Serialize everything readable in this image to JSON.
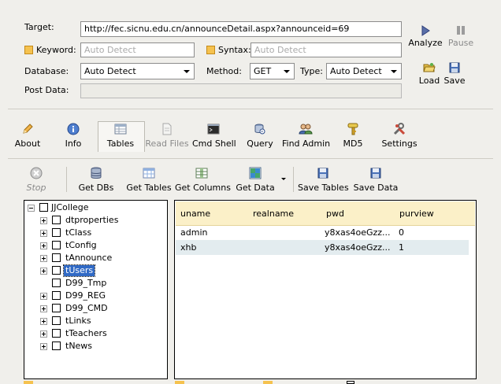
{
  "form": {
    "target_label": "Target:",
    "target_value": "http://fec.sicnu.edu.cn/announceDetail.aspx?announceid=69",
    "keyword_label": "Keyword:",
    "keyword_placeholder": "Auto Detect",
    "syntax_label": "Syntax:",
    "syntax_placeholder": "Auto Detect",
    "database_label": "Database:",
    "database_value": "Auto Detect",
    "method_label": "Method:",
    "method_value": "GET",
    "type_label": "Type:",
    "type_value": "Auto Detect",
    "postdata_label": "Post Data:",
    "postdata_value": ""
  },
  "actions": {
    "analyze": "Analyze",
    "pause": "Pause",
    "load": "Load",
    "save": "Save"
  },
  "tabs": [
    {
      "label": "About",
      "icon": "pen-icon"
    },
    {
      "label": "Info",
      "icon": "info-icon"
    },
    {
      "label": "Tables",
      "icon": "tables-icon"
    },
    {
      "label": "Read Files",
      "icon": "document-icon"
    },
    {
      "label": "Cmd Shell",
      "icon": "terminal-icon"
    },
    {
      "label": "Query",
      "icon": "query-icon"
    },
    {
      "label": "Find Admin",
      "icon": "users-icon"
    },
    {
      "label": "MD5",
      "icon": "key-icon"
    },
    {
      "label": "Settings",
      "icon": "tools-icon"
    }
  ],
  "toolbar": {
    "stop": "Stop",
    "get_dbs": "Get DBs",
    "get_tables": "Get Tables",
    "get_columns": "Get Columns",
    "get_data": "Get Data",
    "save_tables": "Save Tables",
    "save_data": "Save Data"
  },
  "tree": {
    "root": "JJCollege",
    "items": [
      "dtproperties",
      "tClass",
      "tConfig",
      "tAnnounce",
      "tUsers",
      "D99_Tmp",
      "D99_REG",
      "D99_CMD",
      "tLinks",
      "tTeachers",
      "tNews"
    ],
    "selected": "tUsers"
  },
  "grid": {
    "headers": [
      "uname",
      "realname",
      "pwd",
      "purview"
    ],
    "rows": [
      [
        "admin",
        "",
        "y8xas4oeGzz...",
        "0"
      ],
      [
        "xhb",
        "",
        "y8xas4oeGzz...",
        "1"
      ]
    ]
  },
  "colors": {
    "window_bg": "#f0efeb",
    "grid_header_bg": "#fbf0c8",
    "selected_row_bg": "#e3ecef",
    "checkbox_orange": "#f5c24f"
  }
}
